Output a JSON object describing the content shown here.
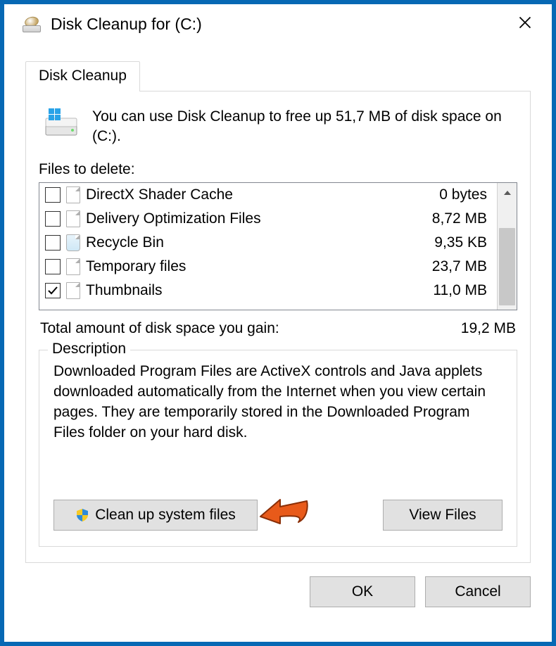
{
  "window": {
    "title": "Disk Cleanup for  (C:)"
  },
  "tab": {
    "label": "Disk Cleanup"
  },
  "intro": "You can use Disk Cleanup to free up 51,7 MB of disk space on  (C:).",
  "files_label": "Files to delete:",
  "files": [
    {
      "name": "DirectX Shader Cache",
      "size": "0 bytes",
      "checked": false,
      "icon": "file"
    },
    {
      "name": "Delivery Optimization Files",
      "size": "8,72 MB",
      "checked": false,
      "icon": "file"
    },
    {
      "name": "Recycle Bin",
      "size": "9,35 KB",
      "checked": false,
      "icon": "recycle"
    },
    {
      "name": "Temporary files",
      "size": "23,7 MB",
      "checked": false,
      "icon": "file"
    },
    {
      "name": "Thumbnails",
      "size": "11,0 MB",
      "checked": true,
      "icon": "file"
    }
  ],
  "total": {
    "label": "Total amount of disk space you gain:",
    "value": "19,2 MB"
  },
  "description": {
    "label": "Description",
    "text": "Downloaded Program Files are ActiveX controls and Java applets downloaded automatically from the Internet when you view certain pages. They are temporarily stored in the Downloaded Program Files folder on your hard disk."
  },
  "buttons": {
    "clean_system": "Clean up system files",
    "view_files": "View Files",
    "ok": "OK",
    "cancel": "Cancel"
  }
}
